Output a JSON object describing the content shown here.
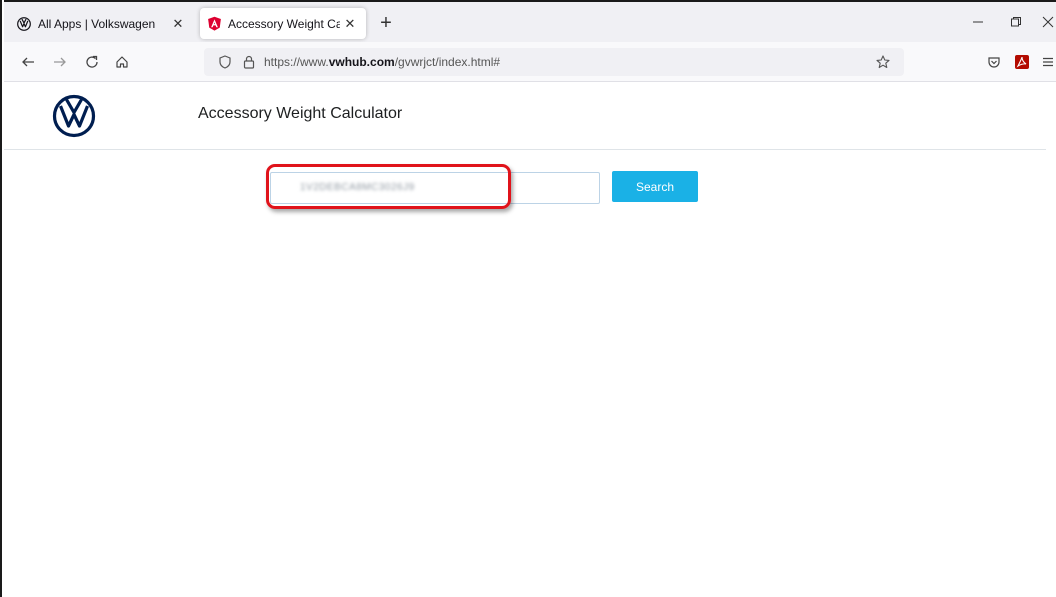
{
  "browser": {
    "tabs": [
      {
        "label": "All Apps | Volkswagen",
        "active": false,
        "favicon": "vw-logo-icon"
      },
      {
        "label": "Accessory Weight Calculator",
        "active": true,
        "favicon": "angular-icon"
      }
    ],
    "url": {
      "prefix": "https://www.",
      "domain": "vwhub.com",
      "path": "/gvwrjct/index.html#"
    }
  },
  "page": {
    "title": "Accessory Weight Calculator",
    "search": {
      "value": "1V2DEBCA8MC3026J9",
      "button_label": "Search"
    }
  },
  "colors": {
    "search_button": "#1ab1e6",
    "highlight": "#e0131b",
    "vw_logo": "#001e50",
    "angular_red": "#dd0031"
  }
}
